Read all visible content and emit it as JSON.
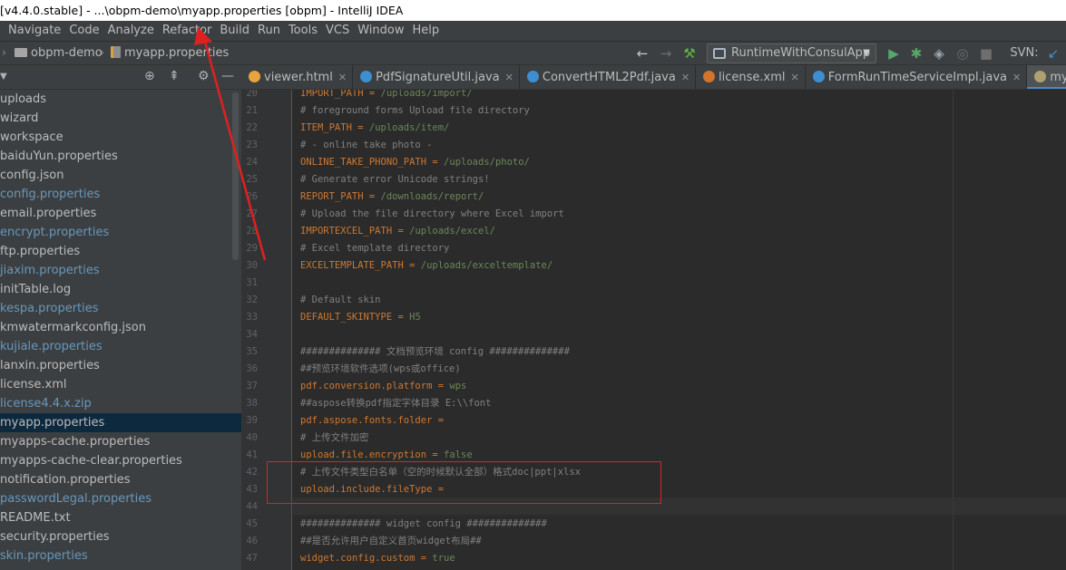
{
  "window": {
    "title": "[v4.4.0.stable] - ...\\obpm-demo\\myapp.properties [obpm] - IntelliJ IDEA"
  },
  "menu": {
    "items": [
      "Navigate",
      "Code",
      "Analyze",
      "Refactor",
      "Build",
      "Run",
      "Tools",
      "VCS",
      "Window",
      "Help"
    ]
  },
  "breadcrumb": {
    "project": "obpm-demo",
    "file": "myapp.properties"
  },
  "toolbar": {
    "run_config": "RuntimeWithConsulApp",
    "svn_label": "SVN:"
  },
  "tree": {
    "items": [
      {
        "label": "uploads",
        "vcs": false
      },
      {
        "label": "wizard",
        "vcs": false
      },
      {
        "label": "workspace",
        "vcs": false
      },
      {
        "label": "baiduYun.properties",
        "vcs": false
      },
      {
        "label": "config.json",
        "vcs": false
      },
      {
        "label": "config.properties",
        "vcs": true
      },
      {
        "label": "email.properties",
        "vcs": false
      },
      {
        "label": "encrypt.properties",
        "vcs": true
      },
      {
        "label": "ftp.properties",
        "vcs": false
      },
      {
        "label": "jiaxim.properties",
        "vcs": true
      },
      {
        "label": "initTable.log",
        "vcs": false
      },
      {
        "label": "kespa.properties",
        "vcs": true
      },
      {
        "label": "kmwatermarkconfig.json",
        "vcs": false
      },
      {
        "label": "kujiale.properties",
        "vcs": true
      },
      {
        "label": "lanxin.properties",
        "vcs": false
      },
      {
        "label": "license.xml",
        "vcs": false
      },
      {
        "label": "license4.4.x.zip",
        "vcs": true
      },
      {
        "label": "myapp.properties",
        "vcs": false,
        "selected": true
      },
      {
        "label": "myapps-cache.properties",
        "vcs": false
      },
      {
        "label": "myapps-cache-clear.properties",
        "vcs": false
      },
      {
        "label": "notification.properties",
        "vcs": false
      },
      {
        "label": "passwordLegal.properties",
        "vcs": true
      },
      {
        "label": "README.txt",
        "vcs": false
      },
      {
        "label": "security.properties",
        "vcs": false
      },
      {
        "label": "skin.properties",
        "vcs": true
      }
    ]
  },
  "tabs": [
    {
      "label": "viewer.html",
      "color": "#e8a33d"
    },
    {
      "label": "PdfSignatureUtil.java",
      "color": "#3d8fd1"
    },
    {
      "label": "ConvertHTML2Pdf.java",
      "color": "#3d8fd1"
    },
    {
      "label": "license.xml",
      "color": "#d4742c"
    },
    {
      "label": "FormRunTimeServiceImpl.java",
      "color": "#3d8fd1"
    },
    {
      "label": "myapp.proper",
      "color": "#b0a070",
      "active": true
    }
  ],
  "editor": {
    "lines": [
      {
        "n": "20",
        "type": "kv",
        "key": "IMPORT_PATH",
        "val": "/uploads/import/"
      },
      {
        "n": "21",
        "type": "comment",
        "text": "# foreground forms Upload file directory"
      },
      {
        "n": "22",
        "type": "kv",
        "key": "ITEM_PATH",
        "val": "/uploads/item/"
      },
      {
        "n": "23",
        "type": "comment",
        "text": "# - online take photo -"
      },
      {
        "n": "24",
        "type": "kv",
        "key": "ONLINE_TAKE_PHONO_PATH",
        "val": "/uploads/photo/"
      },
      {
        "n": "25",
        "type": "comment",
        "text": "# Generate error Unicode strings!"
      },
      {
        "n": "26",
        "type": "kv",
        "key": "REPORT_PATH",
        "val": "/downloads/report/"
      },
      {
        "n": "27",
        "type": "comment",
        "text": "# Upload the file directory where Excel import"
      },
      {
        "n": "28",
        "type": "kv",
        "key": "IMPORTEXCEL_PATH",
        "val": "/uploads/excel/"
      },
      {
        "n": "29",
        "type": "comment",
        "text": "# Excel template directory"
      },
      {
        "n": "30",
        "type": "kv",
        "key": "EXCELTEMPLATE_PATH",
        "val": "/uploads/exceltemplate/"
      },
      {
        "n": "31",
        "type": "blank",
        "text": ""
      },
      {
        "n": "32",
        "type": "comment",
        "text": "# Default skin"
      },
      {
        "n": "33",
        "type": "kv",
        "key": "DEFAULT_SKINTYPE",
        "val": "H5"
      },
      {
        "n": "34",
        "type": "blank",
        "text": ""
      },
      {
        "n": "35",
        "type": "comment",
        "text": "############## 文档预览环境 config ##############"
      },
      {
        "n": "36",
        "type": "comment",
        "text": "##预览环境软件选项(wps或office)"
      },
      {
        "n": "37",
        "type": "kv",
        "key": "pdf.conversion.platform",
        "val": "wps"
      },
      {
        "n": "38",
        "type": "comment",
        "text": "##aspose转换pdf指定字体目录 E:\\\\font"
      },
      {
        "n": "39",
        "type": "kv",
        "key": "pdf.aspose.fonts.folder",
        "val": ""
      },
      {
        "n": "40",
        "type": "comment",
        "text": "# 上传文件加密"
      },
      {
        "n": "41",
        "type": "kv",
        "key": "upload.file.encryption",
        "val": "false"
      },
      {
        "n": "42",
        "type": "comment",
        "text": "# 上传文件类型白名单（空的时候默认全部）格式doc|ppt|xlsx"
      },
      {
        "n": "43",
        "type": "kv",
        "key": "upload.include.fileType",
        "val": ""
      },
      {
        "n": "44",
        "type": "blank",
        "text": ""
      },
      {
        "n": "45",
        "type": "comment",
        "text": "############## widget config ##############"
      },
      {
        "n": "46",
        "type": "comment",
        "text": "##是否允许用户自定义首页widget布局##"
      },
      {
        "n": "47",
        "type": "kv",
        "key": "widget.config.custom",
        "val": "true"
      }
    ]
  },
  "colors": {
    "annotation": "#e02020",
    "vcs_modified": "#6897bb",
    "selection": "#0d293e"
  }
}
